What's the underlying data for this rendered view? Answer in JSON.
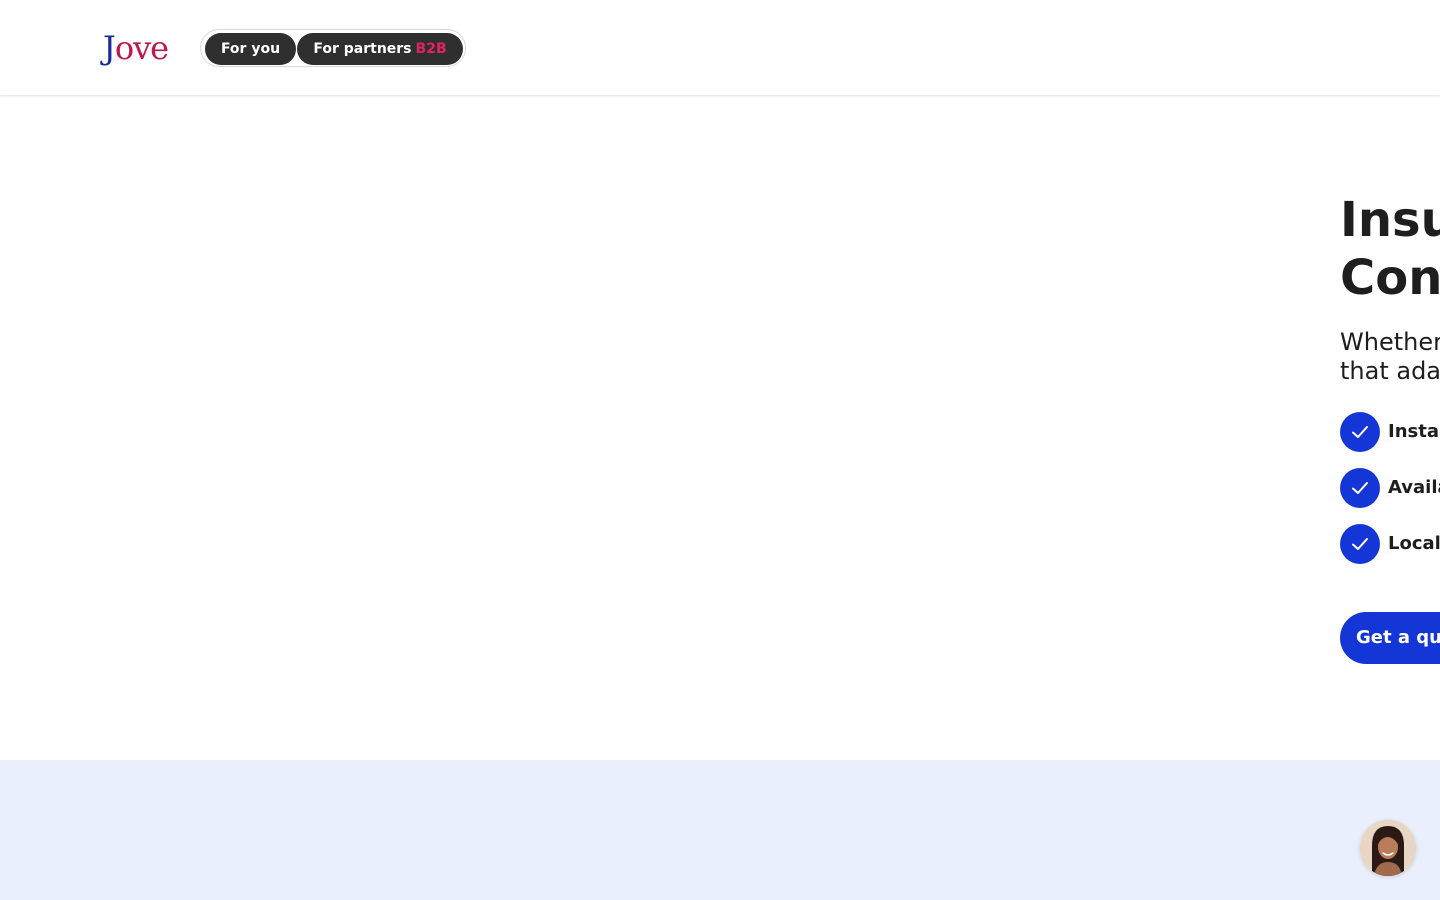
{
  "header": {
    "logo": {
      "first_letter": "J",
      "rest": "ove"
    },
    "tabs": [
      {
        "label": "For you"
      },
      {
        "label": "For partners",
        "badge": "B2B"
      }
    ]
  },
  "hero": {
    "title_line1": "Insu",
    "title_line2": "Con",
    "subtitle_line1": "Whether",
    "subtitle_line2": "that ada",
    "features": [
      {
        "label": "Insta"
      },
      {
        "label": "Availa"
      },
      {
        "label": "Local"
      }
    ],
    "cta_label": "Get a qu"
  },
  "icons": {
    "check": "check-icon",
    "avatar": "chat-avatar"
  },
  "colors": {
    "brand_primary": "#1436d6",
    "logo_accent": "#c0154a",
    "logo_dark": "#1a2a9a",
    "badge": "#e0245e",
    "band_background": "#eaeffd"
  }
}
